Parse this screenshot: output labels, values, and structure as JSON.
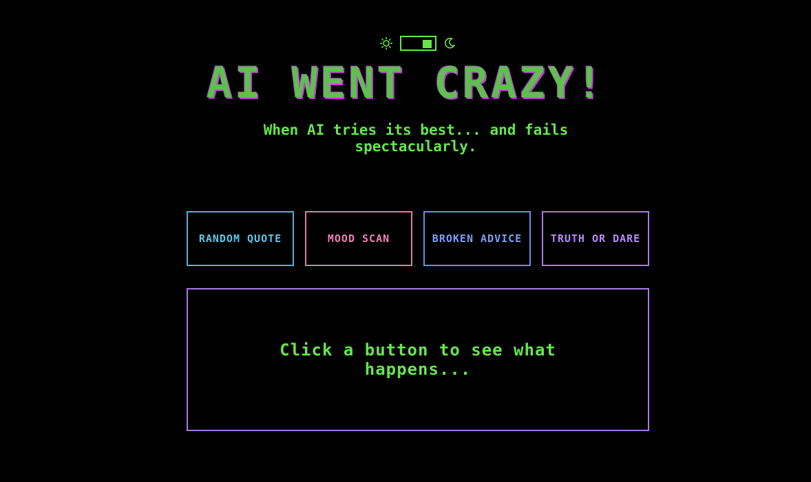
{
  "theme_toggle": {
    "light_icon": "sun-icon",
    "dark_icon": "moon-icon",
    "state": "on"
  },
  "header": {
    "title": "AI WENT CRAZY!",
    "subtitle": "When AI tries its best... and fails spectacularly."
  },
  "buttons": [
    {
      "label": "RANDOM QUOTE",
      "color": "#5cc6e8"
    },
    {
      "label": "MOOD SCAN",
      "color": "#ef7fb5"
    },
    {
      "label": "BROKEN ADVICE",
      "color": "#7aa0f5"
    },
    {
      "label": "TRUTH OR DARE",
      "color": "#b98af5"
    }
  ],
  "output": {
    "text": "Click a button to see what happens..."
  },
  "colors": {
    "background": "#000000",
    "accent_green": "#66e64d",
    "title_shadow": "#c23bd6",
    "output_border": "#a87ae6"
  }
}
